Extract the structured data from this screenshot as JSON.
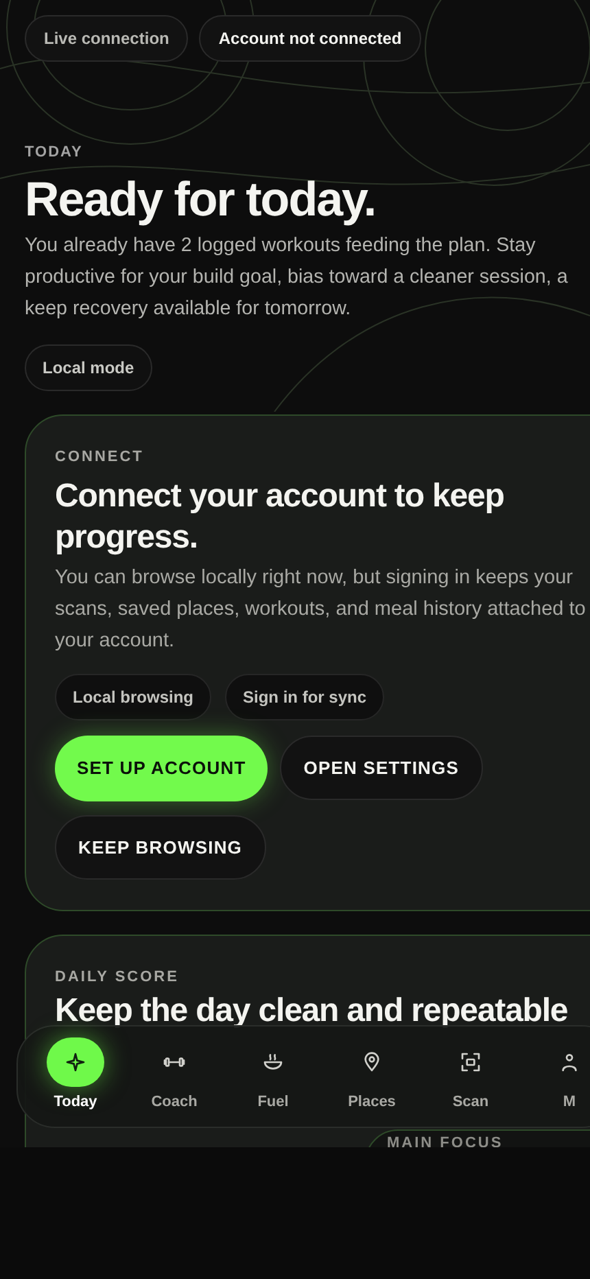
{
  "status_chips": [
    {
      "label": "Live connection",
      "emphasis": false
    },
    {
      "label": "Account not connected",
      "emphasis": true
    }
  ],
  "hero": {
    "eyebrow": "TODAY",
    "title": "Ready for today.",
    "body_lines": [
      "You already have 2 logged workouts feeding the plan. Stay",
      "productive for your build goal, bias toward a cleaner session, a",
      "keep recovery available for tomorrow."
    ],
    "chip": "Local mode"
  },
  "connect_card": {
    "eyebrow": "CONNECT",
    "title": "Connect your account to keep progress.",
    "body_lines": [
      "You can browse locally right now, but signing in keeps your",
      "scans, saved places, workouts, and meal history attached to",
      "your account."
    ],
    "chips": [
      "Local browsing",
      "Sign in for sync"
    ],
    "buttons": [
      {
        "label": "SET UP ACCOUNT",
        "kind": "primary"
      },
      {
        "label": "OPEN SETTINGS",
        "kind": "secondary"
      },
      {
        "label": "KEEP BROWSING",
        "kind": "secondary"
      }
    ]
  },
  "score_card": {
    "eyebrow": "DAILY SCORE",
    "title": "Keep the day clean and repeatable",
    "focus_label": "MAIN FOCUS"
  },
  "nav": [
    {
      "label": "Today",
      "selected": true
    },
    {
      "label": "Coach",
      "selected": false
    },
    {
      "label": "Fuel",
      "selected": false
    },
    {
      "label": "Places",
      "selected": false
    },
    {
      "label": "Scan",
      "selected": false
    },
    {
      "label": "M",
      "selected": false
    }
  ]
}
